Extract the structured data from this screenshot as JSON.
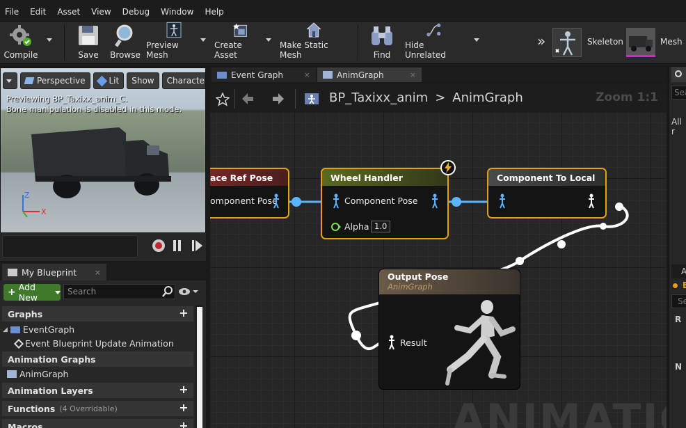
{
  "menu": [
    "File",
    "Edit",
    "Asset",
    "View",
    "Debug",
    "Window",
    "Help"
  ],
  "toolbar": {
    "compile": "Compile",
    "save": "Save",
    "browse": "Browse",
    "preview_mesh": "Preview Mesh",
    "create_asset": "Create Asset",
    "make_static_mesh": "Make Static Mesh",
    "find": "Find",
    "hide_unrelated": "Hide Unrelated",
    "skeleton": "Skeleton",
    "mesh": "Mesh",
    "more": "»"
  },
  "viewport": {
    "perspective": "Perspective",
    "lit": "Lit",
    "show": "Show",
    "character": "Character",
    "line1": "Previewing BP_Taxixx_anim_C.",
    "line2": "Bone manipulation is disabled in this mode.",
    "axis_x": "X",
    "axis_z": "Z"
  },
  "my_blueprint": {
    "tab": "My Blueprint",
    "add_new": "Add New",
    "search_placeholder": "Search",
    "graphs": "Graphs",
    "event_graph": "EventGraph",
    "event_update": "Event Blueprint Update Animation",
    "animation_graphs": "Animation Graphs",
    "anim_graph": "AnimGraph",
    "animation_layers": "Animation Layers",
    "functions": "Functions",
    "functions_note": "(4 Overridable)",
    "macros": "Macros"
  },
  "graph_tabs": [
    "Event Graph",
    "AnimGraph"
  ],
  "graph": {
    "crumb_root": "BP_Taxixx_anim",
    "crumb_sep": ">",
    "crumb_leaf": "AnimGraph",
    "zoom": "Zoom 1:1",
    "watermark": "ANIMATION",
    "nodes": {
      "ref_pose_title": "ace Ref Pose",
      "ref_pose_pin": "omponent Pose",
      "wheel_title": "Wheel Handler",
      "wheel_pin": "Component Pose",
      "alpha_label": "Alpha",
      "alpha_value": "1.0",
      "c2l_title": "Component To Local",
      "output_title": "Output Pose",
      "output_sub": "AnimGraph",
      "result": "Result"
    }
  },
  "right_panel": {
    "search": "Sea",
    "all": "All r",
    "an": "An",
    "e": "E",
    "se": "Se",
    "r": "R",
    "n": "N"
  },
  "colors": {
    "node_border_selected": "#e8a013",
    "pose_wire": "#5ab4ff",
    "exec_wire": "#ffffff",
    "add_new_green": "#3f7a2b",
    "title_red": "#7a2626",
    "title_olive": "#5a6a1e",
    "title_gray": "#4a4a4a"
  }
}
